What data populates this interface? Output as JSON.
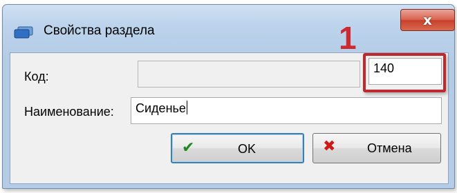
{
  "window": {
    "title": "Свойства раздела",
    "close_glyph": "x"
  },
  "form": {
    "code_label": "Код:",
    "code_prefix_value": "",
    "code_value": "140",
    "name_label": "Наименование:",
    "name_value": "Сиденье"
  },
  "annotation": {
    "number": "1",
    "color": "#c0282f"
  },
  "buttons": {
    "ok_label": "OK",
    "ok_icon": "check-icon",
    "cancel_label": "Отмена",
    "cancel_icon": "cross-icon"
  }
}
